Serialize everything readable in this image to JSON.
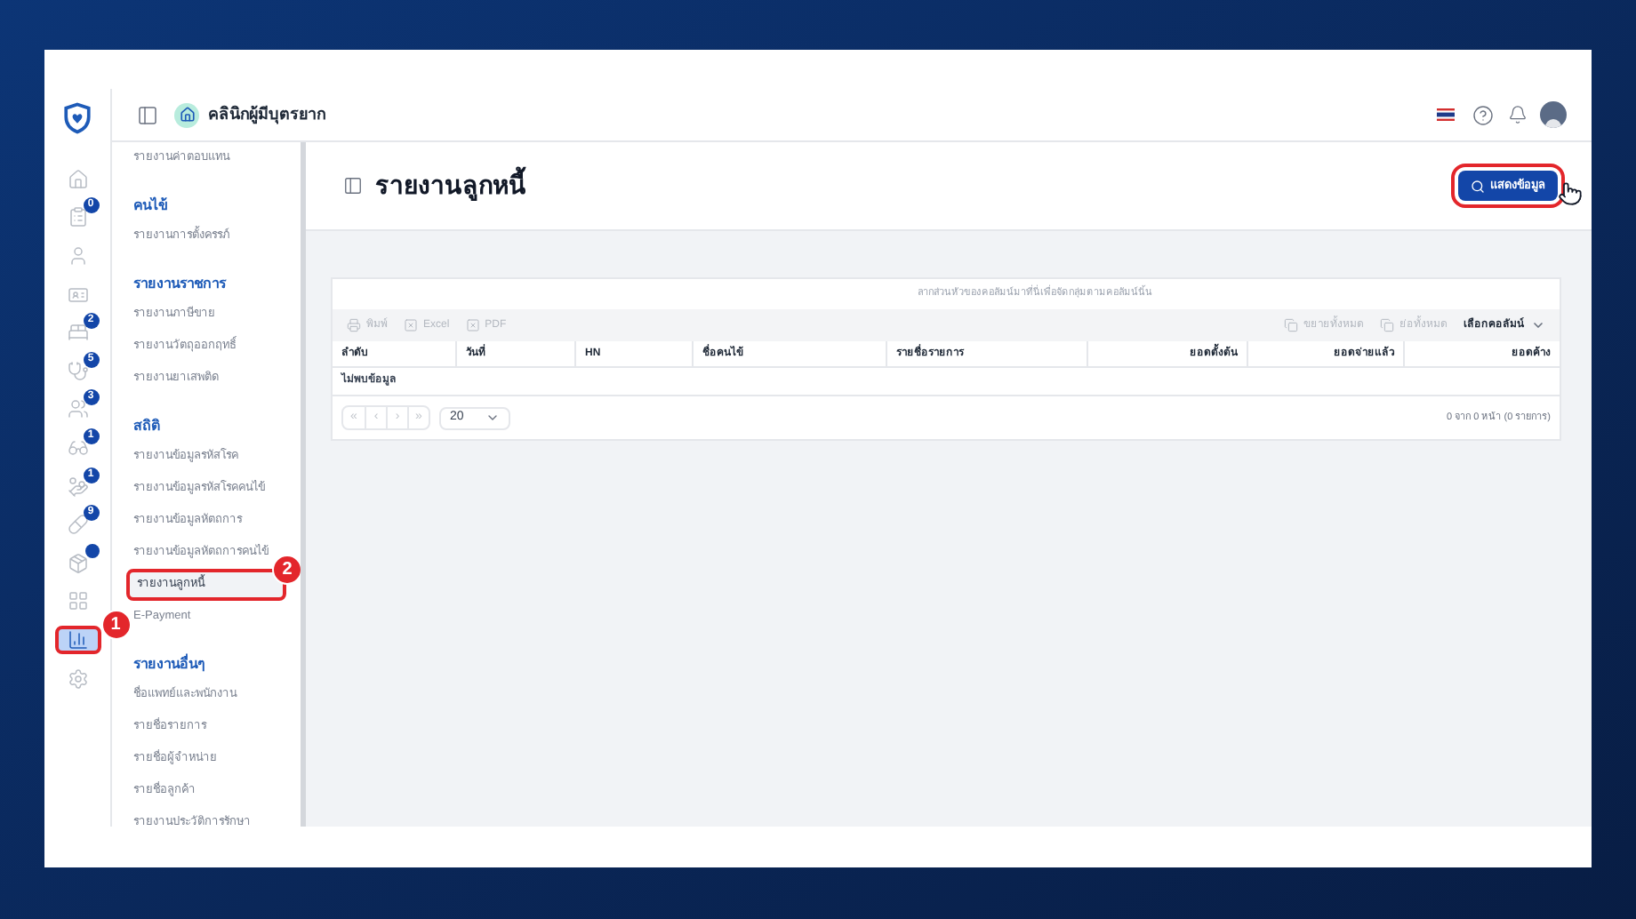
{
  "header": {
    "clinic_name": "คลินิกผู้มีบุตรยาก"
  },
  "rail": [
    {
      "selected": false
    },
    {
      "selected": false,
      "badge": "0"
    },
    {
      "selected": false
    },
    {
      "selected": false
    },
    {
      "selected": false,
      "badge": "2"
    },
    {
      "selected": false,
      "badge": "5"
    },
    {
      "selected": false,
      "badge": "3"
    },
    {
      "selected": false,
      "badge": "1"
    },
    {
      "selected": false,
      "badge": "1"
    },
    {
      "selected": false,
      "badge": "9"
    },
    {
      "selected": false,
      "dot": true
    },
    {
      "selected": false
    },
    {
      "selected": true,
      "callout": "1"
    },
    {
      "selected": false
    }
  ],
  "sidebar": {
    "sections": [
      {
        "items": [
          {
            "label": "รายงานค่าตอบแทน",
            "selected": false
          }
        ]
      },
      {
        "title": "คนไข้",
        "items": [
          {
            "label": "รายงานการตั้งครรภ์",
            "selected": false
          }
        ]
      },
      {
        "title": "รายงานราชการ",
        "items": [
          {
            "label": "รายงานภาษีขาย",
            "selected": false
          },
          {
            "label": "รายงานวัตถุออกฤทธิ์",
            "selected": false
          },
          {
            "label": "รายงานยาเสพติด",
            "selected": false
          }
        ]
      },
      {
        "title": "สถิติ",
        "items": [
          {
            "label": "รายงานข้อมูลรหัสโรค",
            "selected": false
          },
          {
            "label": "รายงานข้อมูลรหัสโรคคนไข้",
            "selected": false
          },
          {
            "label": "รายงานข้อมูลหัตถการ",
            "selected": false
          },
          {
            "label": "รายงานข้อมูลหัตถการคนไข้",
            "selected": false
          },
          {
            "label": "รายงานลูกหนี้",
            "selected": true,
            "callout": "2"
          },
          {
            "label": "E-Payment",
            "selected": false
          }
        ]
      },
      {
        "title": "รายงานอื่นๆ",
        "items": [
          {
            "label": "ชื่อแพทย์และพนักงาน",
            "selected": false
          },
          {
            "label": "รายชื่อรายการ",
            "selected": false
          },
          {
            "label": "รายชื่อผู้จำหน่าย",
            "selected": false
          },
          {
            "label": "รายชื่อลูกค้า",
            "selected": false
          },
          {
            "label": "รายงานประวัติการรักษา",
            "selected": false
          }
        ]
      }
    ]
  },
  "page": {
    "title": "รายงานลูกหนี้",
    "show_button": {
      "label": "แสดงข้อมูล",
      "highlighted": true
    }
  },
  "table": {
    "group_hint": "ลากส่วนหัวของคอลัมน์มาที่นี่เพื่อจัดกลุ่มตามคอลัมน์นั้น",
    "export_buttons": [
      {
        "label": "พิมพ์",
        "disabled": true
      },
      {
        "label": "Excel",
        "disabled": true
      },
      {
        "label": "PDF",
        "disabled": true
      }
    ],
    "tree_buttons": [
      {
        "label": "ขยายทั้งหมด",
        "disabled": true
      },
      {
        "label": "ย่อทั้งหมด",
        "disabled": true
      }
    ],
    "column_chooser": "เลือกคอลัมน์",
    "columns": [
      {
        "label": "ลำดับ"
      },
      {
        "label": "วันที่"
      },
      {
        "label": "HN"
      },
      {
        "label": "ชื่อคนไข้"
      },
      {
        "label": "รายชื่อรายการ"
      },
      {
        "label": "ยอดตั้งต้น"
      },
      {
        "label": "ยอดจ่ายแล้ว"
      },
      {
        "label": "ยอดค้าง"
      }
    ],
    "empty_text": "ไม่พบข้อมูล",
    "pager": {
      "buttons": [
        {
          "label": "«",
          "disabled": true
        },
        {
          "label": "‹",
          "disabled": true
        },
        {
          "label": "›",
          "disabled": true
        },
        {
          "label": "»",
          "disabled": true
        }
      ],
      "page_size": "20",
      "summary": "0 จาก 0 หน้า (0 รายการ)"
    }
  }
}
